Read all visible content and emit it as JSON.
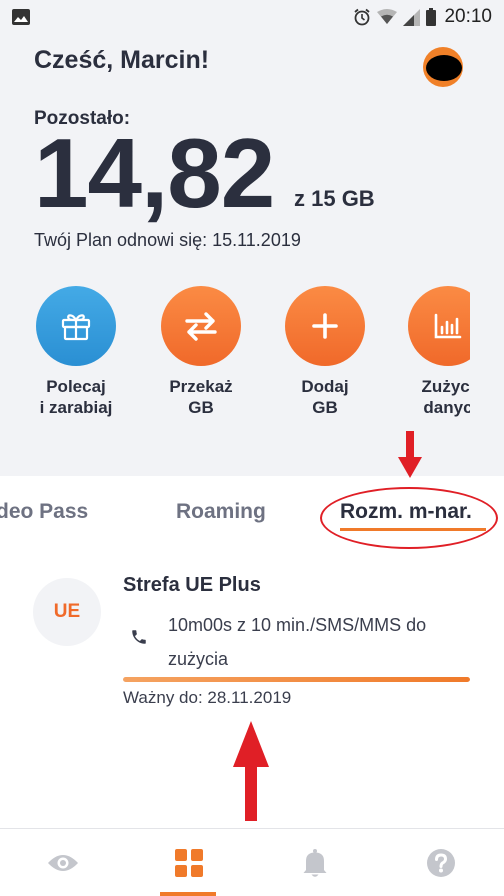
{
  "status_bar": {
    "time": "20:10"
  },
  "header": {
    "greeting": "Cześć, Marcin!"
  },
  "balance": {
    "label": "Pozostało:",
    "value": "14,82",
    "of_total": "z 15 GB",
    "renew_text": "Twój Plan odnowi się: 15.11.2019"
  },
  "actions": [
    {
      "line1": "Polecaj",
      "line2": "i zarabiaj",
      "icon": "gift-icon",
      "color": "#3a9fdf"
    },
    {
      "line1": "Przekaż",
      "line2": "GB",
      "icon": "transfer-arrows-icon",
      "color": "#f47a35"
    },
    {
      "line1": "Dodaj",
      "line2": "GB",
      "icon": "plus-icon",
      "color": "#f47a35"
    },
    {
      "line1": "Zużyci",
      "line2": "danyc",
      "icon": "usage-chart-icon",
      "color": "#f47a35"
    }
  ],
  "tabs": [
    {
      "label": "deo Pass",
      "active": false
    },
    {
      "label": "Roaming",
      "active": false
    },
    {
      "label": "Rozm. m-nar.",
      "active": true
    }
  ],
  "offer": {
    "badge": "UE",
    "title": "Strefa UE Plus",
    "description": "10m00s z 10 min./SMS/MMS do zużycia",
    "progress": 1.0,
    "valid_until": "Ważny do: 28.11.2019"
  },
  "bottom_nav": [
    {
      "icon": "eye-icon",
      "active": false
    },
    {
      "icon": "grid-icon",
      "active": true
    },
    {
      "icon": "bell-icon",
      "active": false
    },
    {
      "icon": "help-icon",
      "active": false
    }
  ],
  "colors": {
    "accent": "#f07a2a",
    "blue": "#3a9fdf",
    "text_dark": "#2b2f3e",
    "annotation_red": "#e01f26",
    "background_top": "#f2f3f6"
  }
}
